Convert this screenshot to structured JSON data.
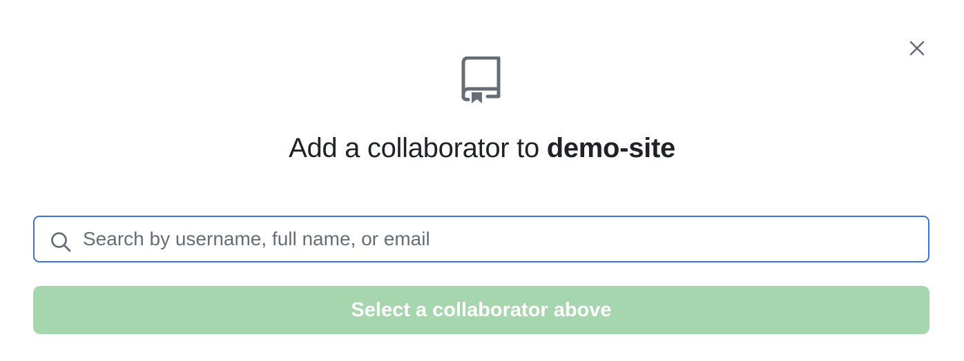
{
  "dialog": {
    "title_prefix": "Add a collaborator to ",
    "repo_name": "demo-site",
    "close_icon": "close-icon",
    "header_icon": "repo-icon"
  },
  "search": {
    "placeholder": "Search by username, full name, or email",
    "value": "",
    "icon": "search-icon"
  },
  "submit": {
    "label": "Select a collaborator above",
    "disabled": true
  },
  "colors": {
    "focus_border": "#3a70d8",
    "disabled_button_bg": "#a6d6ae",
    "icon_gray": "#656d76",
    "text": "#1f2328"
  }
}
